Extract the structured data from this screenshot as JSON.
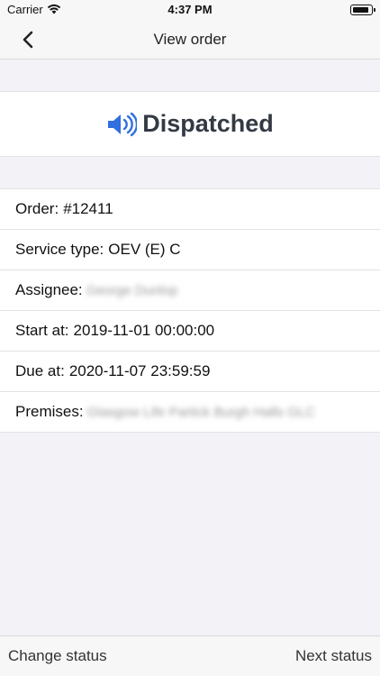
{
  "status_bar": {
    "carrier": "Carrier",
    "time": "4:37 PM",
    "wifi_icon": "wifi-icon",
    "battery_icon": "battery-icon"
  },
  "nav": {
    "title": "View order",
    "back_icon": "chevron-left-icon"
  },
  "order_status": {
    "label": "Dispatched",
    "icon": "speaker-icon",
    "icon_color": "#2f6fe0"
  },
  "details": [
    {
      "label": "Order:",
      "value": "#12411"
    },
    {
      "label": "Service type:",
      "value": "OEV (E) C"
    },
    {
      "label": "Assignee:",
      "value": "George Dunlop",
      "redacted": true
    },
    {
      "label": "Start at:",
      "value": "2019-11-01 00:00:00"
    },
    {
      "label": "Due at:",
      "value": "2020-11-07 23:59:59"
    },
    {
      "label": "Premises:",
      "value": "Glasgow Life Partick Burgh Halls GLC",
      "redacted": true
    }
  ],
  "toolbar": {
    "change_status": "Change status",
    "next_status": "Next status"
  }
}
